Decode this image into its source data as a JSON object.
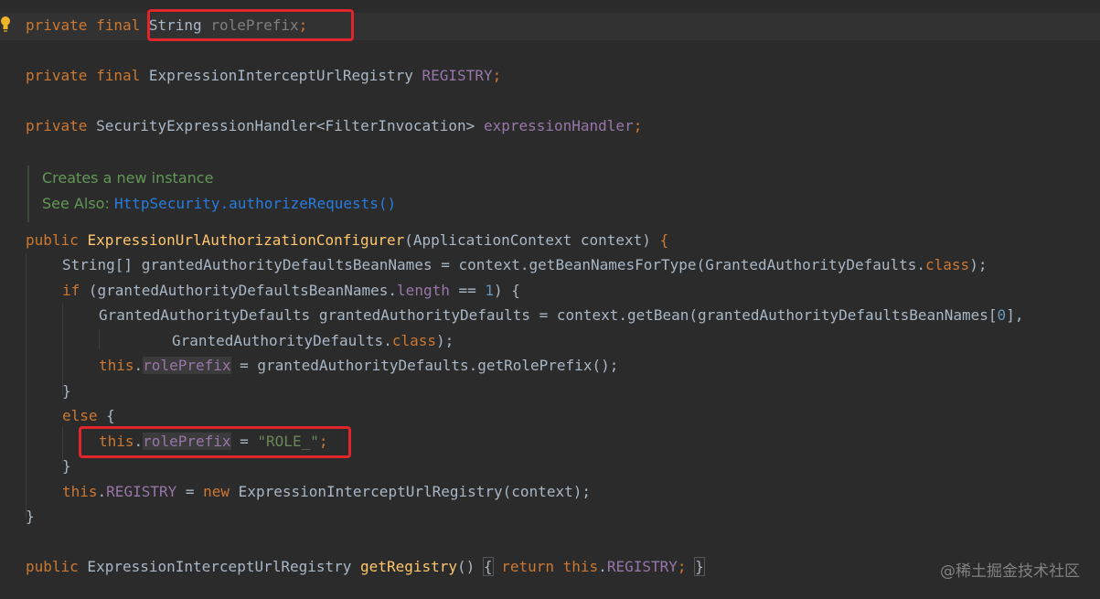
{
  "editor": {
    "line1": {
      "private": "private",
      "final": "final",
      "type": "String",
      "field": "rolePrefix",
      "semi": ";"
    },
    "line2": {
      "private": "private",
      "final": "final",
      "type": "ExpressionInterceptUrlRegistry",
      "field": "REGISTRY",
      "semi": ";"
    },
    "line3": {
      "private": "private",
      "type": "SecurityExpressionHandler<FilterInvocation>",
      "field": "expressionHandler",
      "semi": ";"
    },
    "doc": {
      "line1": "Creates a new instance",
      "see_also_label": "See Also:",
      "see_also_link": "HttpSecurity.authorizeRequests()"
    },
    "ctor": {
      "public": "public",
      "name": "ExpressionUrlAuthorizationConfigurer",
      "params": "(ApplicationContext context) ",
      "brace": "{"
    },
    "l5": {
      "a": "String[] grantedAuthorityDefaultsBeanNames = context.getBeanNamesForType(GrantedAuthorityDefaults.",
      "kw": "class",
      "b": ");"
    },
    "l6": {
      "if": "if",
      "a": " (grantedAuthorityDefaultsBeanNames.",
      "fld": "length",
      "b": " == ",
      "num": "1",
      "c": ") {"
    },
    "l7": {
      "a": "GrantedAuthorityDefaults grantedAuthorityDefaults = context.getBean(grantedAuthorityDefaultsBeanNames[",
      "num": "0",
      "b": "],"
    },
    "l8": {
      "a": "GrantedAuthorityDefaults.",
      "kw": "class",
      "b": ");"
    },
    "l9": {
      "this": "this",
      "dot": ".",
      "fld": "rolePrefix",
      "b": " = grantedAuthorityDefaults.getRolePrefix();"
    },
    "l10": {
      "brace": "}"
    },
    "l11": {
      "else": "else",
      "brace": " {"
    },
    "l12": {
      "this": "this",
      "dot": ".",
      "fld": "rolePrefix",
      "b": " = ",
      "str": "\"ROLE_\"",
      "semi": ";"
    },
    "l13": {
      "brace": "}"
    },
    "l14": {
      "this": "this",
      "dot": ".",
      "fld": "REGISTRY",
      "b": " = ",
      "new": "new",
      "c": " ExpressionInterceptUrlRegistry(context);"
    },
    "l15": {
      "brace": "}"
    },
    "getter": {
      "public": "public",
      "type": " ExpressionInterceptUrlRegistry ",
      "name": "getRegistry",
      "paren": "()",
      "ob": "{",
      "return": "return",
      "this": "this",
      "dot": ".",
      "fld": "REGISTRY",
      "semi": ";",
      "cb": "}"
    }
  },
  "watermark": "@稀土掘金技术社区",
  "colors": {
    "background": "#2b2b2b",
    "keyword": "#cc7832",
    "field": "#9876aa",
    "method": "#ffc66d",
    "string": "#6a8759",
    "number": "#6897bb",
    "highlight_box": "#e0262a"
  }
}
